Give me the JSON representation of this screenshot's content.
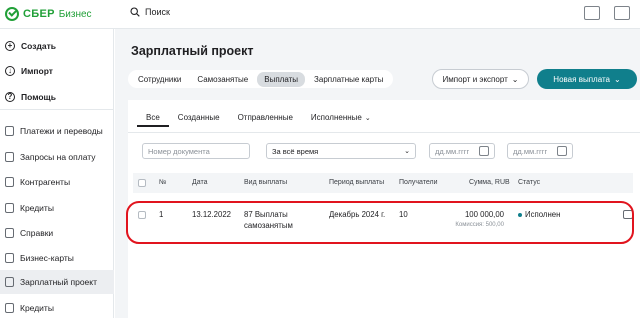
{
  "brand": {
    "name": "СБЕР",
    "product": "Бизнес"
  },
  "search": {
    "label": "Поиск"
  },
  "sidebar": {
    "actions": [
      {
        "label": "Создать",
        "glyph": "+"
      },
      {
        "label": "Импорт",
        "glyph": "↓"
      },
      {
        "label": "Помощь",
        "glyph": "?"
      }
    ],
    "items": [
      {
        "label": "Платежи и переводы"
      },
      {
        "label": "Запросы на оплату"
      },
      {
        "label": "Контрагенты"
      },
      {
        "label": "Кредиты"
      },
      {
        "label": "Справки"
      },
      {
        "label": "Бизнес-карты"
      },
      {
        "label": "Зарплатный проект"
      },
      {
        "label": "Кредиты"
      }
    ],
    "active_item": "Зарплатный проект"
  },
  "page": {
    "title": "Зарплатный проект"
  },
  "tabs": [
    {
      "label": "Сотрудники"
    },
    {
      "label": "Самозанятые"
    },
    {
      "label": "Выплаты"
    },
    {
      "label": "Зарплатные карты"
    }
  ],
  "active_tab": "Выплаты",
  "buttons": {
    "import_export": "Импорт и экспорт",
    "new_payment": "Новая выплата"
  },
  "filter_tabs": [
    {
      "label": "Все"
    },
    {
      "label": "Созданные"
    },
    {
      "label": "Отправленные"
    },
    {
      "label": "Исполненные"
    }
  ],
  "active_filter_tab": "Все",
  "filters": {
    "doc_number_placeholder": "Номер документа",
    "period_value": "За всё время",
    "date_from_placeholder": "дд.мм.гггг",
    "date_to_placeholder": "дд.мм.гггг"
  },
  "table": {
    "columns": [
      "№",
      "Дата",
      "Вид выплаты",
      "Период выплаты",
      "Получатели",
      "Сумма, RUB",
      "Статус"
    ],
    "rows": [
      {
        "number": "1",
        "date": "13.12.2022",
        "type_line1": "87 Выплаты",
        "type_line2": "самозанятым",
        "period": "Декабрь 2024 г.",
        "recipients": "10",
        "amount": "100 000,00",
        "commission": "Комиссия: 500,00",
        "status": "Исполнен"
      }
    ]
  },
  "colors": {
    "brand_green": "#21a038",
    "accent_teal": "#107f8c",
    "highlight_red": "#e1141e"
  }
}
